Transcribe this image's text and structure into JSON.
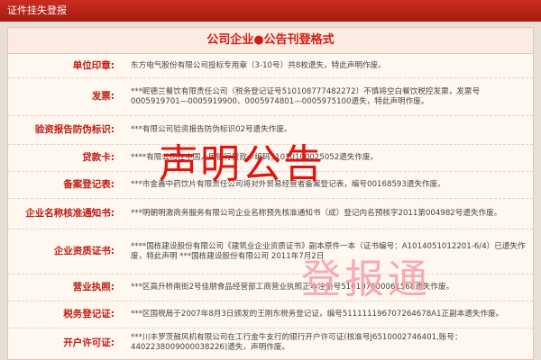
{
  "top_bar": {
    "title": "证件挂失登报"
  },
  "panel": {
    "title": "公司企业●公告刊登格式",
    "rows": [
      {
        "label": "单位印章:",
        "content": "东方电气股份有限公司投标专用章（3-10号）共8枚遗失，特此声明作废。"
      },
      {
        "label": "发票:",
        "content": "***昵德兰餐饮有限责任公司（税务登记证号510108777482272）不慎将空白餐饮税控发票，发票号0005919701—0005919900、0005974801—0005975100遗失，特此声明作废。"
      },
      {
        "label": "验资报告防伪标识:",
        "content": "***有限公司验资报告防伪标识02号遗失作废。"
      },
      {
        "label": "贷款卡:",
        "content": "****有限公司在中国人民银行贷款卡编码51010100025052遗失作废。"
      },
      {
        "label": "备案登记表:",
        "content": "***市金鑫中药饮片有限责任公司将对外贸易经营者备案登记表，编号00168593遗失作废。"
      },
      {
        "label": "企业名称核准通知书:",
        "content": "***明朝明激商务服务有限公司企业名称预先核准通知书（成）登记内名预核字2011第004982号遗失作废。"
      },
      {
        "label": "企业资质证书:",
        "content": "****国栋建设股份有限公司《建筑业企业资质证书》副本原件一本（证书编号：A1014051012201-6/4）已遗失作废，特此声明 ***国栋建设股份有限公司 2011年7月2日"
      },
      {
        "label": "营业执照:",
        "content": "***区高升桥南街2号佳朋食品经营部工商营业执照正本注册号510107600061568遗失作废。"
      },
      {
        "label": "税务登记证:",
        "content": "***区国税局于2007年8月3日颁发的王刚东税务登记证，编号511111196707264678A1正副本遗失作废。"
      },
      {
        "label": "开户许可证:",
        "content": "***川丰罗茨鼓风机有限公司在工行金牛支行的银行开户许可证(核准号J6510002746401,账号：4402238009000038226)遗失，声明作废。"
      }
    ]
  },
  "overlay": {
    "title": "声明公告",
    "brand": "登报通"
  }
}
